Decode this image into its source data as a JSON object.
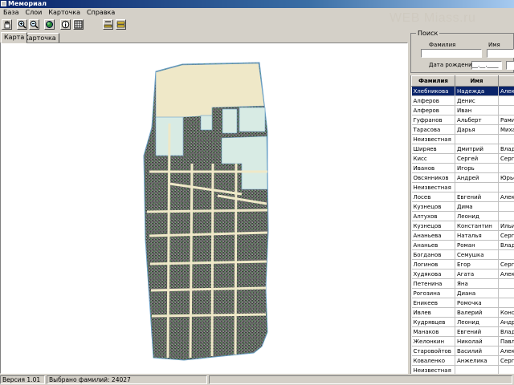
{
  "window": {
    "title": "Мемориал"
  },
  "watermark": "WEB Miass.ru",
  "menu": [
    "База",
    "Слои",
    "Карточка",
    "Справка"
  ],
  "toolbar": {
    "buttons": [
      "hand-pan-icon",
      "zoom-in-icon",
      "zoom-out-icon",
      "globe-icon",
      "info-icon",
      "grid-icon",
      "ruler-icon",
      "layers-icon"
    ]
  },
  "tabs": [
    "Карта",
    "Карточка"
  ],
  "search": {
    "group_label": "Поиск",
    "surname_label": "Фамилия",
    "name_label": "Имя",
    "birthdate_label": "Дата рождения",
    "birthdate_value": "__.__.____"
  },
  "grid": {
    "columns": [
      "Фамилия",
      "Имя",
      "От"
    ],
    "rows": [
      [
        "Хлебникова",
        "Надежда",
        "Алек"
      ],
      [
        "Алферов",
        "Денис",
        ""
      ],
      [
        "Алферов",
        "Иван",
        ""
      ],
      [
        "Гуфранов",
        "Альберт",
        "Рами"
      ],
      [
        "Тарасова",
        "Дарья",
        "Миха"
      ],
      [
        "Неизвестная",
        "",
        ""
      ],
      [
        "Ширяев",
        "Дмитрий",
        "Влад"
      ],
      [
        "Кисс",
        "Сергей",
        "Серге"
      ],
      [
        "Иванов",
        "Игорь",
        ""
      ],
      [
        "Овсянников",
        "Андрей",
        "Юрье"
      ],
      [
        "Неизвестная",
        "",
        ""
      ],
      [
        "Лосев",
        "Евгений",
        "Алек"
      ],
      [
        "Кузнецов",
        "Дима",
        ""
      ],
      [
        "Алтухов",
        "Леонид",
        ""
      ],
      [
        "Кузнецов",
        "Константин",
        "Ильи"
      ],
      [
        "Ананьева",
        "Наталья",
        "Серге"
      ],
      [
        "Ананьев",
        "Роман",
        "Влад"
      ],
      [
        "Богданов",
        "Семушка",
        ""
      ],
      [
        "Логинов",
        "Егор",
        "Серге"
      ],
      [
        "Худякова",
        "Агата",
        "Алек"
      ],
      [
        "Петенина",
        "Яна",
        ""
      ],
      [
        "Рогозина",
        "Диана",
        ""
      ],
      [
        "Еникеев",
        "Ромочка",
        ""
      ],
      [
        "Ивлев",
        "Валерий",
        "Конс"
      ],
      [
        "Кудрявцев",
        "Леонид",
        "Андр"
      ],
      [
        "Манаков",
        "Евгений",
        "Влад"
      ],
      [
        "Желонкин",
        "Николай",
        "Павл"
      ],
      [
        "Старовойтов",
        "Василий",
        "Алек"
      ],
      [
        "Коваленко",
        "Анжелика",
        "Серге"
      ],
      [
        "Неизвестная",
        "",
        ""
      ]
    ],
    "selected_row": 0
  },
  "status": {
    "version": "Версия 1.01",
    "selected": "Выбрано фамилий: 24027"
  },
  "colors": {
    "selection": "#0a246a",
    "map_paper": "#efe8c8",
    "map_water": "#d8ebe4",
    "map_graves": "#5a5a5a",
    "map_trees": "#3c8a3c"
  }
}
